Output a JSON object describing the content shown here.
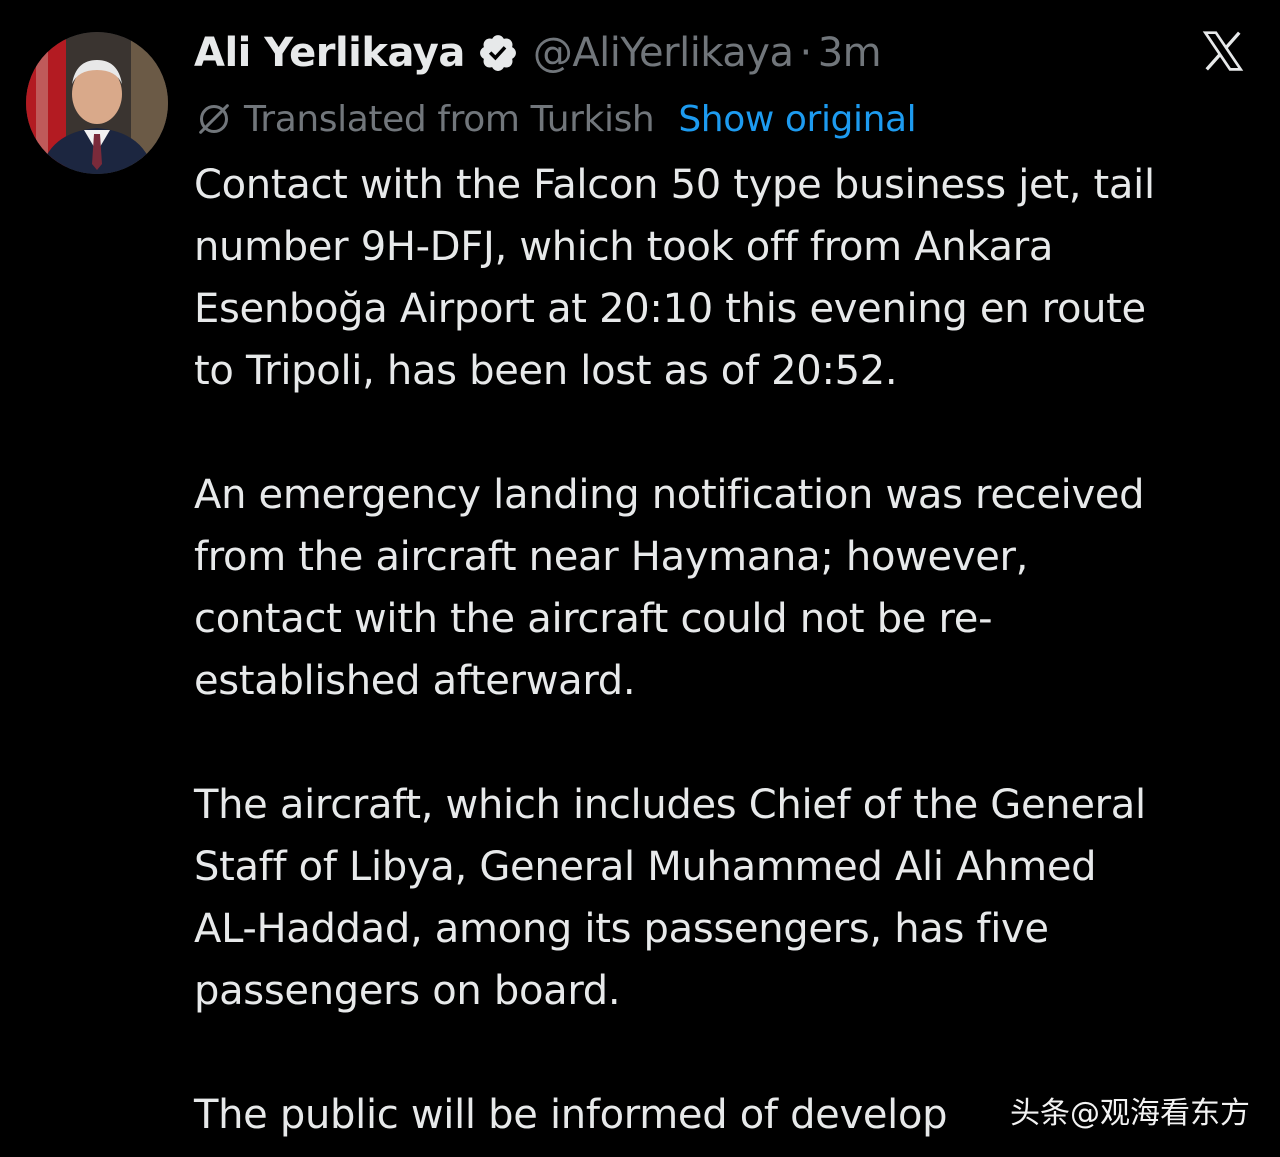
{
  "author": {
    "display_name": "Ali Yerlikaya",
    "verified_icon": "verified-badge-icon",
    "handle": "@AliYerlikaya",
    "separator": "·",
    "time": "3m"
  },
  "platform_icon": "x-logo-icon",
  "translation": {
    "icon": "translate-off-icon",
    "label": "Translated from Turkish",
    "show_original_label": "Show original"
  },
  "body": {
    "paragraphs": [
      [
        "Contact with the Falcon 50 type business jet, tail",
        "number 9H-DFJ, which took off from Ankara",
        "Esenboğa Airport at 20:10 this evening en route",
        "to Tripoli, has been lost as of 20:52."
      ],
      [
        "An emergency landing notification was received",
        "from the aircraft near Haymana; however,",
        "contact with the aircraft could not be re-",
        "established afterward."
      ],
      [
        "The aircraft, which includes Chief of the General",
        "Staff of Libya, General Muhammed Ali Ahmed",
        "AL-Haddad, among its passengers, has five",
        "passengers on board."
      ],
      [
        "The public will be informed of develop"
      ]
    ]
  },
  "watermark": "头条@观海看东方",
  "colors": {
    "background": "#000000",
    "text_primary": "#e7e9ea",
    "text_secondary": "#71767b",
    "link": "#1d9bf0",
    "verified": "#1d9bf0"
  }
}
